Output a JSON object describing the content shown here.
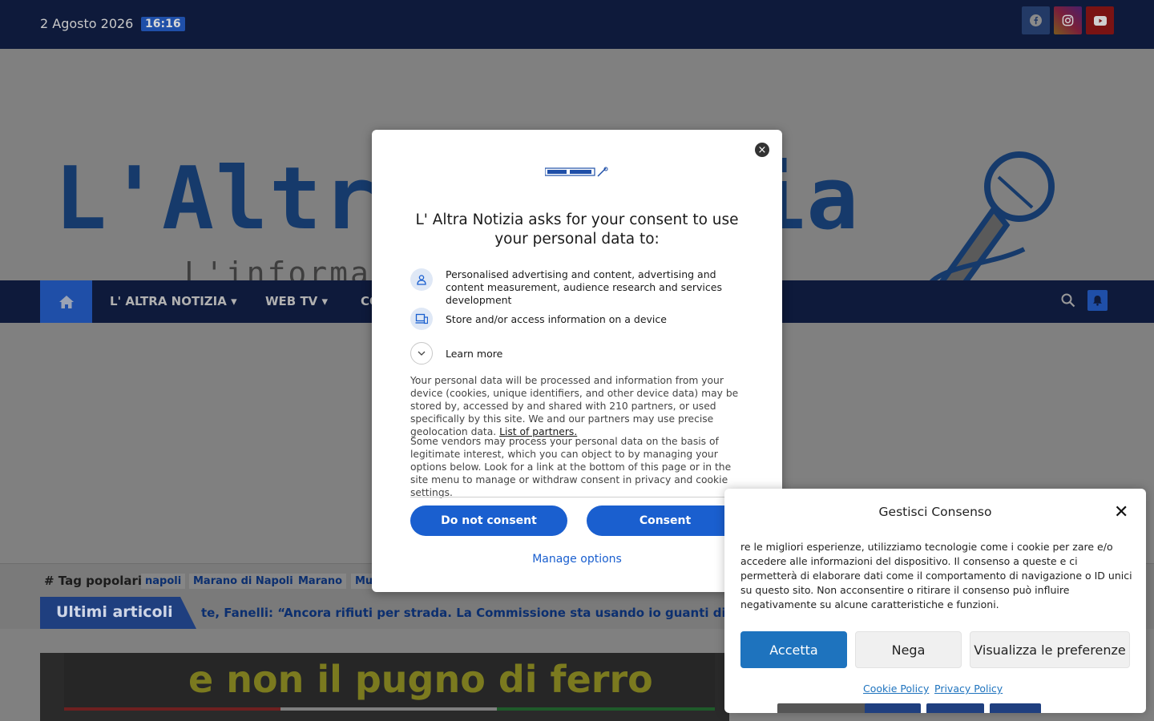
{
  "topbar": {
    "date": "2 Agosto 2026",
    "time": "16:16"
  },
  "social": [
    "facebook-icon",
    "instagram-icon",
    "youtube-icon"
  ],
  "header": {
    "logo_text": "L'Altra Notizia",
    "tagline": "L'informazione libera"
  },
  "nav": {
    "items": [
      "L' ALTRA NOTIZIA",
      "WEB TV",
      "CO"
    ]
  },
  "tags": {
    "label": "# Tag popolari",
    "items": [
      "napoli",
      "Marano di Napoli",
      "Marano",
      "Mu"
    ]
  },
  "ticker": {
    "label": "Ultimi articoli",
    "text": "te, Fanelli: “Ancora rifiuti per strada. La Commissione sta usando io guanti di vellu"
  },
  "feature": {
    "headline": "e non il pugno di ferro"
  },
  "consent_modal": {
    "title": "L' Altra Notizia asks for your consent to use your personal data to:",
    "purposes": [
      "Personalised advertising and content, advertising and content measurement, audience research and services development",
      "Store and/or access information on a device"
    ],
    "learn_more": "Learn more",
    "paragraph1": "Your personal data will be processed and information from your device (cookies, unique identifiers, and other device data) may be stored by, accessed by and shared with 210 partners, or used specifically by this site. We and our partners may use precise geolocation data.",
    "partners_link": "List of partners.",
    "paragraph2": "Some vendors may process your personal data on the basis of legitimate interest, which you can object to by managing your options below. Look for a link at the bottom of this page or in the site menu to manage or withdraw consent in privacy and cookie settings.",
    "do_not_consent": "Do not consent",
    "consent": "Consent",
    "manage_options": "Manage options"
  },
  "cookie_panel": {
    "title": "Gestisci Consenso",
    "text": "re le migliori esperienze, utilizziamo tecnologie come i cookie per zare e/o accedere alle informazioni del dispositivo. Il consenso a queste e ci permetterà di elaborare dati come il comportamento di navigazione o ID unici su questo sito. Non acconsentire o ritirare il consenso può influire negativamente su alcune caratteristiche e funzioni.",
    "accept": "Accetta",
    "deny": "Nega",
    "preferences": "Visualizza le preferenze",
    "cookie_policy": "Cookie Policy",
    "privacy_policy": "Privacy Policy"
  },
  "colors": {
    "primary": "#1a5fcf",
    "cookie_accent": "#1e73be",
    "navy": "#0e1a3b"
  }
}
